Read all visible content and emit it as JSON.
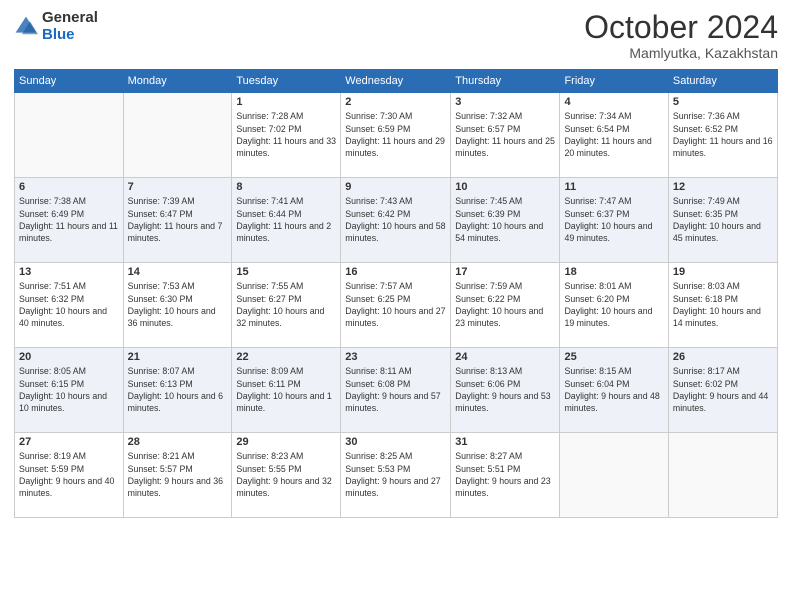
{
  "logo": {
    "general": "General",
    "blue": "Blue"
  },
  "title": {
    "month": "October 2024",
    "location": "Mamlyutka, Kazakhstan"
  },
  "weekdays": [
    "Sunday",
    "Monday",
    "Tuesday",
    "Wednesday",
    "Thursday",
    "Friday",
    "Saturday"
  ],
  "weeks": [
    [
      {
        "day": "",
        "info": ""
      },
      {
        "day": "",
        "info": ""
      },
      {
        "day": "1",
        "info": "Sunrise: 7:28 AM\nSunset: 7:02 PM\nDaylight: 11 hours and 33 minutes."
      },
      {
        "day": "2",
        "info": "Sunrise: 7:30 AM\nSunset: 6:59 PM\nDaylight: 11 hours and 29 minutes."
      },
      {
        "day": "3",
        "info": "Sunrise: 7:32 AM\nSunset: 6:57 PM\nDaylight: 11 hours and 25 minutes."
      },
      {
        "day": "4",
        "info": "Sunrise: 7:34 AM\nSunset: 6:54 PM\nDaylight: 11 hours and 20 minutes."
      },
      {
        "day": "5",
        "info": "Sunrise: 7:36 AM\nSunset: 6:52 PM\nDaylight: 11 hours and 16 minutes."
      }
    ],
    [
      {
        "day": "6",
        "info": "Sunrise: 7:38 AM\nSunset: 6:49 PM\nDaylight: 11 hours and 11 minutes."
      },
      {
        "day": "7",
        "info": "Sunrise: 7:39 AM\nSunset: 6:47 PM\nDaylight: 11 hours and 7 minutes."
      },
      {
        "day": "8",
        "info": "Sunrise: 7:41 AM\nSunset: 6:44 PM\nDaylight: 11 hours and 2 minutes."
      },
      {
        "day": "9",
        "info": "Sunrise: 7:43 AM\nSunset: 6:42 PM\nDaylight: 10 hours and 58 minutes."
      },
      {
        "day": "10",
        "info": "Sunrise: 7:45 AM\nSunset: 6:39 PM\nDaylight: 10 hours and 54 minutes."
      },
      {
        "day": "11",
        "info": "Sunrise: 7:47 AM\nSunset: 6:37 PM\nDaylight: 10 hours and 49 minutes."
      },
      {
        "day": "12",
        "info": "Sunrise: 7:49 AM\nSunset: 6:35 PM\nDaylight: 10 hours and 45 minutes."
      }
    ],
    [
      {
        "day": "13",
        "info": "Sunrise: 7:51 AM\nSunset: 6:32 PM\nDaylight: 10 hours and 40 minutes."
      },
      {
        "day": "14",
        "info": "Sunrise: 7:53 AM\nSunset: 6:30 PM\nDaylight: 10 hours and 36 minutes."
      },
      {
        "day": "15",
        "info": "Sunrise: 7:55 AM\nSunset: 6:27 PM\nDaylight: 10 hours and 32 minutes."
      },
      {
        "day": "16",
        "info": "Sunrise: 7:57 AM\nSunset: 6:25 PM\nDaylight: 10 hours and 27 minutes."
      },
      {
        "day": "17",
        "info": "Sunrise: 7:59 AM\nSunset: 6:22 PM\nDaylight: 10 hours and 23 minutes."
      },
      {
        "day": "18",
        "info": "Sunrise: 8:01 AM\nSunset: 6:20 PM\nDaylight: 10 hours and 19 minutes."
      },
      {
        "day": "19",
        "info": "Sunrise: 8:03 AM\nSunset: 6:18 PM\nDaylight: 10 hours and 14 minutes."
      }
    ],
    [
      {
        "day": "20",
        "info": "Sunrise: 8:05 AM\nSunset: 6:15 PM\nDaylight: 10 hours and 10 minutes."
      },
      {
        "day": "21",
        "info": "Sunrise: 8:07 AM\nSunset: 6:13 PM\nDaylight: 10 hours and 6 minutes."
      },
      {
        "day": "22",
        "info": "Sunrise: 8:09 AM\nSunset: 6:11 PM\nDaylight: 10 hours and 1 minute."
      },
      {
        "day": "23",
        "info": "Sunrise: 8:11 AM\nSunset: 6:08 PM\nDaylight: 9 hours and 57 minutes."
      },
      {
        "day": "24",
        "info": "Sunrise: 8:13 AM\nSunset: 6:06 PM\nDaylight: 9 hours and 53 minutes."
      },
      {
        "day": "25",
        "info": "Sunrise: 8:15 AM\nSunset: 6:04 PM\nDaylight: 9 hours and 48 minutes."
      },
      {
        "day": "26",
        "info": "Sunrise: 8:17 AM\nSunset: 6:02 PM\nDaylight: 9 hours and 44 minutes."
      }
    ],
    [
      {
        "day": "27",
        "info": "Sunrise: 8:19 AM\nSunset: 5:59 PM\nDaylight: 9 hours and 40 minutes."
      },
      {
        "day": "28",
        "info": "Sunrise: 8:21 AM\nSunset: 5:57 PM\nDaylight: 9 hours and 36 minutes."
      },
      {
        "day": "29",
        "info": "Sunrise: 8:23 AM\nSunset: 5:55 PM\nDaylight: 9 hours and 32 minutes."
      },
      {
        "day": "30",
        "info": "Sunrise: 8:25 AM\nSunset: 5:53 PM\nDaylight: 9 hours and 27 minutes."
      },
      {
        "day": "31",
        "info": "Sunrise: 8:27 AM\nSunset: 5:51 PM\nDaylight: 9 hours and 23 minutes."
      },
      {
        "day": "",
        "info": ""
      },
      {
        "day": "",
        "info": ""
      }
    ]
  ]
}
